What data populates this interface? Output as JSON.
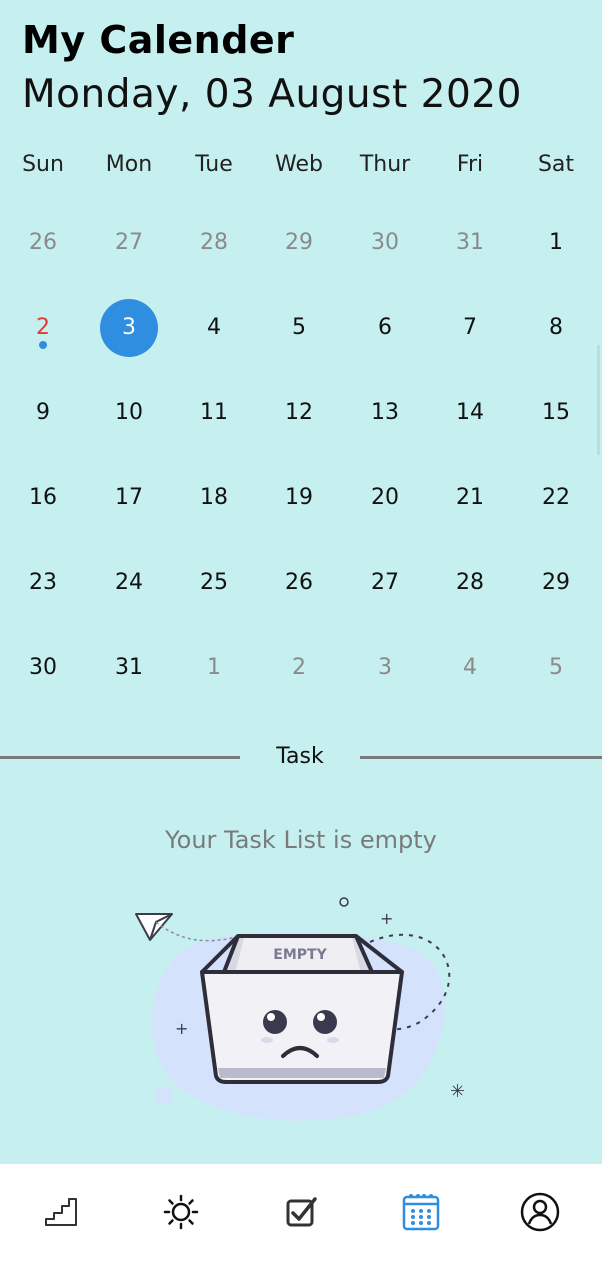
{
  "header": {
    "title": "My Calender",
    "date": "Monday, 03 August 2020"
  },
  "calendar": {
    "weekdays": [
      "Sun",
      "Mon",
      "Tue",
      "Web",
      "Thur",
      "Fri",
      "Sat"
    ],
    "rows": [
      [
        "26",
        "27",
        "28",
        "29",
        "30",
        "31",
        "1"
      ],
      [
        "2",
        "3",
        "4",
        "5",
        "6",
        "7",
        "8"
      ],
      [
        "9",
        "10",
        "11",
        "12",
        "13",
        "14",
        "15"
      ],
      [
        "16",
        "17",
        "18",
        "19",
        "20",
        "21",
        "22"
      ],
      [
        "23",
        "24",
        "25",
        "26",
        "27",
        "28",
        "29"
      ],
      [
        "30",
        "31",
        "1",
        "2",
        "3",
        "4",
        "5"
      ]
    ],
    "muted": [
      [
        true,
        true,
        true,
        true,
        true,
        true,
        false
      ],
      [
        false,
        false,
        false,
        false,
        false,
        false,
        false
      ],
      [
        false,
        false,
        false,
        false,
        false,
        false,
        false
      ],
      [
        false,
        false,
        false,
        false,
        false,
        false,
        false
      ],
      [
        false,
        false,
        false,
        false,
        false,
        false,
        false
      ],
      [
        false,
        false,
        true,
        true,
        true,
        true,
        true
      ]
    ],
    "selected_day": "3",
    "highlight_day": "2",
    "colors": {
      "selected": "#2f8ee0",
      "highlight": "#e53935",
      "muted": "#8a8a8a"
    }
  },
  "tasks": {
    "section_label": "Task",
    "empty_message": "Your Task List is empty",
    "illustration_label": "EMPTY"
  },
  "bottom_nav": {
    "items": [
      {
        "name": "stairs-icon",
        "active": false
      },
      {
        "name": "sun-icon",
        "active": false
      },
      {
        "name": "checkbox-icon",
        "active": false
      },
      {
        "name": "calendar-icon",
        "active": true
      },
      {
        "name": "profile-icon",
        "active": false
      }
    ],
    "active_color": "#2f8ee0"
  }
}
